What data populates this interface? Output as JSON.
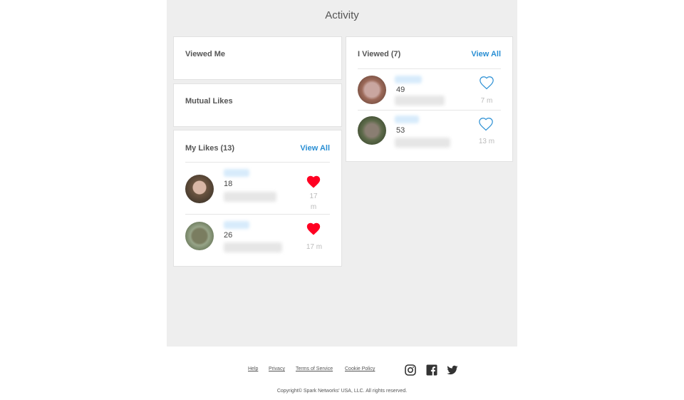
{
  "header": {
    "title": "Activity"
  },
  "viewed_me": {
    "title": "Viewed Me"
  },
  "mutual_likes": {
    "title": "Mutual Likes"
  },
  "my_likes": {
    "title": "My Likes (13)",
    "view_all": "View All",
    "items": [
      {
        "age": "18",
        "time": "17 m",
        "liked": true
      },
      {
        "age": "26",
        "time": "17 m",
        "liked": true
      }
    ]
  },
  "i_viewed": {
    "title": "I Viewed (7)",
    "view_all": "View All",
    "items": [
      {
        "age": "49",
        "time": "7 m",
        "liked": false
      },
      {
        "age": "53",
        "time": "13 m",
        "liked": false
      }
    ]
  },
  "footer": {
    "links": [
      "Help",
      "Privacy",
      "Terms of Service",
      "Cookie Policy"
    ],
    "social": [
      "instagram-icon",
      "facebook-icon",
      "twitter-icon"
    ],
    "copyright": "Copyright© Spark Networks' USA, LLC. All rights reserved."
  },
  "colors": {
    "accent": "#2a8fd4",
    "heart": "#ff0022",
    "background": "#eeeeee"
  }
}
